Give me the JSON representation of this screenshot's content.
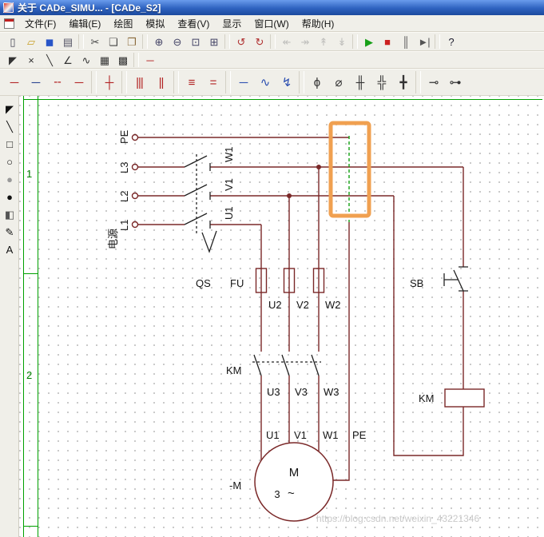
{
  "window": {
    "title": "关于 CADe_SIMU... - [CADe_S2]"
  },
  "menu": {
    "items": [
      {
        "name": "menu-file",
        "label": "文件(F)"
      },
      {
        "name": "menu-edit",
        "label": "编辑(E)"
      },
      {
        "name": "menu-draw",
        "label": "绘图"
      },
      {
        "name": "menu-simulate",
        "label": "模拟"
      },
      {
        "name": "menu-view",
        "label": "查看(V)"
      },
      {
        "name": "menu-display",
        "label": "显示"
      },
      {
        "name": "menu-window",
        "label": "窗口(W)"
      },
      {
        "name": "menu-help",
        "label": "帮助(H)"
      }
    ]
  },
  "toolbars": {
    "main": [
      {
        "name": "new-button",
        "glyph": "▯",
        "color": "#445"
      },
      {
        "name": "open-button",
        "glyph": "▱",
        "color": "#c8a028"
      },
      {
        "name": "save-button",
        "glyph": "◼",
        "color": "#2855c8"
      },
      {
        "name": "print-button",
        "glyph": "▤",
        "color": "#556"
      },
      {
        "name": "separator"
      },
      {
        "name": "cut-button",
        "glyph": "✂",
        "color": "#444"
      },
      {
        "name": "copy-button",
        "glyph": "❏",
        "color": "#444"
      },
      {
        "name": "paste-button",
        "glyph": "❐",
        "color": "#8a6a3a"
      },
      {
        "name": "separator"
      },
      {
        "name": "zoom-in-button",
        "glyph": "⊕",
        "color": "#446"
      },
      {
        "name": "zoom-out-button",
        "glyph": "⊖",
        "color": "#446"
      },
      {
        "name": "zoom-window-button",
        "glyph": "⊡",
        "color": "#446"
      },
      {
        "name": "zoom-fit-button",
        "glyph": "⊞",
        "color": "#446"
      },
      {
        "name": "separator"
      },
      {
        "name": "undo-button",
        "glyph": "↺",
        "color": "#b03030"
      },
      {
        "name": "redo-button",
        "glyph": "↻",
        "color": "#b03030"
      },
      {
        "name": "separator"
      },
      {
        "name": "sim-tool-1-button",
        "glyph": "↞",
        "color": "#9a9a9a",
        "enabled": false
      },
      {
        "name": "sim-tool-2-button",
        "glyph": "↠",
        "color": "#9a9a9a",
        "enabled": false
      },
      {
        "name": "sim-tool-3-button",
        "glyph": "↟",
        "color": "#9a9a9a",
        "enabled": false
      },
      {
        "name": "sim-tool-4-button",
        "glyph": "↡",
        "color": "#9a9a9a",
        "enabled": false
      },
      {
        "name": "separator"
      },
      {
        "name": "run-button",
        "glyph": "▶",
        "color": "#18a018"
      },
      {
        "name": "stop-button",
        "glyph": "■",
        "color": "#cc2020"
      },
      {
        "name": "pause-button",
        "glyph": "║",
        "color": "#555"
      },
      {
        "name": "step-button",
        "glyph": "►|",
        "color": "#555"
      },
      {
        "name": "separator"
      },
      {
        "name": "help-button",
        "glyph": "?",
        "color": "#223"
      }
    ],
    "draw": [
      {
        "name": "pointer-tool",
        "glyph": "◤",
        "color": "#333"
      },
      {
        "name": "erase-tool",
        "glyph": "×",
        "color": "#333"
      },
      {
        "name": "line-tool",
        "glyph": "╲",
        "color": "#333"
      },
      {
        "name": "angle-line-tool",
        "glyph": "∠",
        "color": "#333"
      },
      {
        "name": "curve-tool",
        "glyph": "∿",
        "color": "#333"
      },
      {
        "name": "grid-tool",
        "glyph": "▦",
        "color": "#333"
      },
      {
        "name": "snap-tool",
        "glyph": "▩",
        "color": "#333"
      },
      {
        "name": "separator"
      },
      {
        "name": "wire-tool",
        "glyph": "─",
        "color": "#b22222"
      }
    ],
    "symbols": [
      {
        "name": "power-wire-tool",
        "glyph": "─",
        "color": "#b22222"
      },
      {
        "name": "neutral-wire-tool",
        "glyph": "─",
        "color": "#26418f"
      },
      {
        "name": "dashed-wire-tool",
        "glyph": "╌",
        "color": "#b22222"
      },
      {
        "name": "control-wire-tool",
        "glyph": "─",
        "color": "#b22222"
      },
      {
        "name": "separator"
      },
      {
        "name": "wire-junction-tool",
        "glyph": "┼",
        "color": "#b22222"
      },
      {
        "name": "separator"
      },
      {
        "name": "three-phase-tool",
        "glyph": "|||",
        "color": "#b22222"
      },
      {
        "name": "two-phase-tool",
        "glyph": "||",
        "color": "#b22222"
      },
      {
        "name": "separator"
      },
      {
        "name": "bus-three-tool",
        "glyph": "≡",
        "color": "#b22222"
      },
      {
        "name": "bus-two-tool",
        "glyph": "=",
        "color": "#b22222"
      },
      {
        "name": "separator"
      },
      {
        "name": "blue-wire-tool",
        "glyph": "─",
        "color": "#2a4db0"
      },
      {
        "name": "flex-wire-tool",
        "glyph": "∿",
        "color": "#2a4db0"
      },
      {
        "name": "arrow-wire-tool",
        "glyph": "↯",
        "color": "#2a4db0"
      },
      {
        "name": "separator"
      },
      {
        "name": "pole-one-tool",
        "glyph": "ϕ",
        "color": "#333"
      },
      {
        "name": "pole-two-tool",
        "glyph": "⌀",
        "color": "#333"
      },
      {
        "name": "contact-two-tool",
        "glyph": "╫",
        "color": "#333"
      },
      {
        "name": "contact-three-tool",
        "glyph": "╬",
        "color": "#333"
      },
      {
        "name": "contact-four-tool",
        "glyph": "╋",
        "color": "#333"
      },
      {
        "name": "separator"
      },
      {
        "name": "terminal-left-tool",
        "glyph": "⊸",
        "color": "#333"
      },
      {
        "name": "terminal-right-tool",
        "glyph": "⊶",
        "color": "#333"
      }
    ],
    "shapes": [
      {
        "name": "select-tool",
        "glyph": "◤",
        "color": "#111"
      },
      {
        "name": "line-shape-tool",
        "glyph": "╲",
        "color": "#111"
      },
      {
        "name": "rectangle-tool",
        "glyph": "□",
        "color": "#111"
      },
      {
        "name": "circle-tool",
        "glyph": "○",
        "color": "#111"
      },
      {
        "name": "ellipse-tool",
        "glyph": "●",
        "color": "#9a9a9a"
      },
      {
        "name": "filled-circle-tool",
        "glyph": "●",
        "color": "#111"
      },
      {
        "name": "fill-tool",
        "glyph": "◧",
        "color": "#555"
      },
      {
        "name": "pen-tool",
        "glyph": "✎",
        "color": "#111"
      },
      {
        "name": "text-tool",
        "glyph": "A",
        "color": "#111"
      }
    ]
  },
  "sheet": {
    "rows": [
      "1",
      "2"
    ]
  },
  "circuit": {
    "labels": {
      "pe_top": "PE",
      "l3": "L3",
      "l2": "L2",
      "l1": "L1",
      "power": "电源",
      "w1_sw": "W1",
      "v1_sw": "V1",
      "u1_sw": "U1",
      "qs": "QS",
      "fu": "FU",
      "u2": "U2",
      "v2": "V2",
      "w2": "W2",
      "km_contact": "KM",
      "u3": "U3",
      "v3": "V3",
      "w3": "W3",
      "u1_motor": "U1",
      "v1_motor": "V1",
      "w1_motor": "W1",
      "pe_motor": "PE",
      "sb": "SB",
      "km_coil": "KM",
      "motor_tag": "-M",
      "motor_m": "M",
      "motor_phases": "3",
      "motor_ac": "~"
    }
  },
  "canvas": {
    "watermark": "https://blog.csdn.net/weixin_43221346"
  },
  "colors": {
    "wire": "#7a2828",
    "mechanism": "#222222",
    "pe_dash": "#12a012",
    "highlight": "#f0a050",
    "sheet_frame": "#00a000",
    "titlebar": "#2e62c0"
  }
}
